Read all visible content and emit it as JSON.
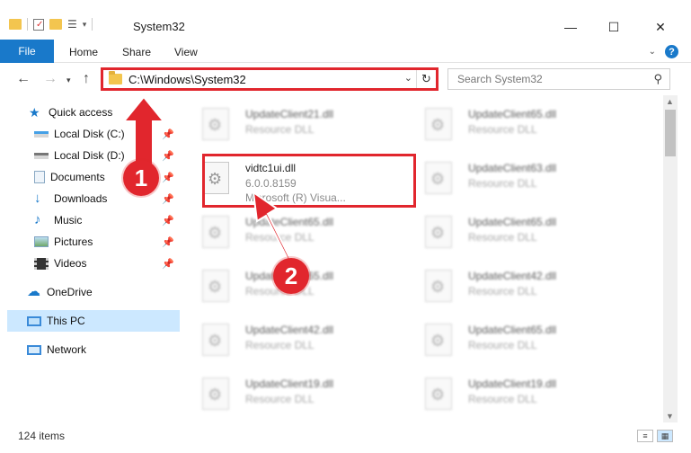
{
  "window": {
    "title": "System32",
    "minimize": "—",
    "maximize": "☐",
    "close": "✕"
  },
  "ribbon": {
    "file": "File",
    "tabs": [
      "Home",
      "Share",
      "View"
    ]
  },
  "nav": {
    "address": "C:\\Windows\\System32",
    "search_placeholder": "Search System32"
  },
  "sidebar": {
    "items": [
      {
        "label": "Quick access",
        "icon": "star-icon",
        "pinned": false
      },
      {
        "label": "Local Disk (C:)",
        "icon": "drive-icon",
        "pinned": true
      },
      {
        "label": "Local Disk (D:)",
        "icon": "drive-icon",
        "pinned": true
      },
      {
        "label": "Documents",
        "icon": "documents-icon",
        "pinned": true
      },
      {
        "label": "Downloads",
        "icon": "downloads-icon",
        "pinned": true
      },
      {
        "label": "Music",
        "icon": "music-icon",
        "pinned": true
      },
      {
        "label": "Pictures",
        "icon": "pictures-icon",
        "pinned": true
      },
      {
        "label": "Videos",
        "icon": "videos-icon",
        "pinned": true
      },
      {
        "label": "OneDrive",
        "icon": "onedrive-icon",
        "pinned": false
      },
      {
        "label": "This PC",
        "icon": "pc-icon",
        "pinned": false,
        "selected": true
      },
      {
        "label": "Network",
        "icon": "network-icon",
        "pinned": false
      }
    ]
  },
  "files": {
    "left": [
      {
        "name": "UpdateClient21.dll",
        "desc": "Resource DLL"
      },
      {
        "name": "vidtc1ui.dll",
        "desc": "6.0.0.8159",
        "desc2": "Microsoft (R) Visua..."
      },
      {
        "name": "UpdateClient65.dll",
        "desc": "Resource DLL"
      },
      {
        "name": "UpdateClient65.dll",
        "desc": "Resource DLL"
      },
      {
        "name": "UpdateClient42.dll",
        "desc": "Resource DLL"
      },
      {
        "name": "UpdateClient19.dll",
        "desc": "Resource DLL"
      }
    ],
    "right": [
      {
        "name": "UpdateClient65.dll",
        "desc": "Resource DLL"
      },
      {
        "name": "UpdateClient63.dll",
        "desc": "Resource DLL"
      },
      {
        "name": "UpdateClient65.dll",
        "desc": "Resource DLL"
      },
      {
        "name": "UpdateClient42.dll",
        "desc": "Resource DLL"
      },
      {
        "name": "UpdateClient65.dll",
        "desc": "Resource DLL"
      },
      {
        "name": "UpdateClient19.dll",
        "desc": "Resource DLL"
      }
    ]
  },
  "status": {
    "count": "124 items"
  },
  "callouts": {
    "one": "1",
    "two": "2"
  },
  "colors": {
    "accent": "#1979ca",
    "highlight": "#e1262d",
    "selected": "#cce8ff"
  }
}
